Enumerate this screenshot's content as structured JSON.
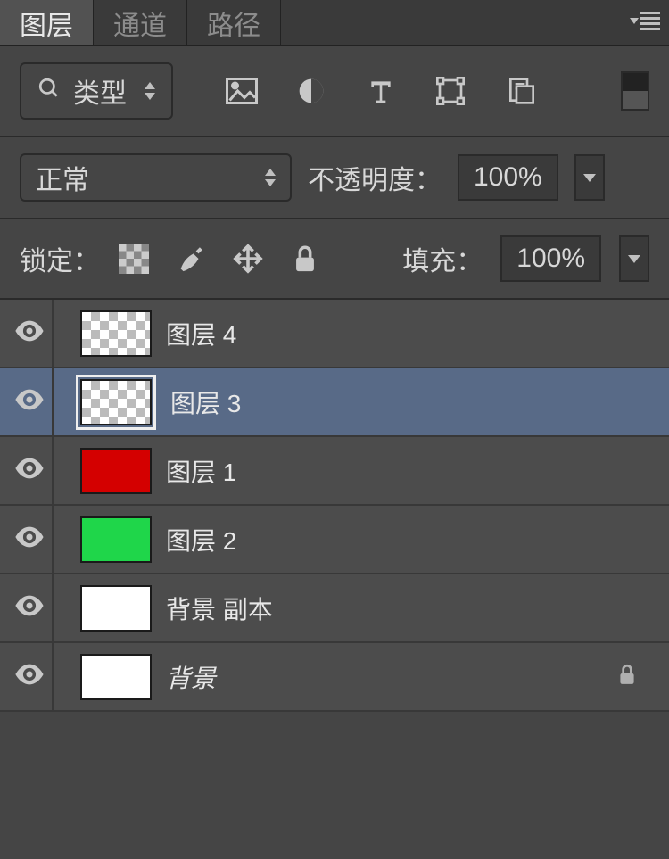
{
  "tabs": {
    "active": "图层",
    "items": [
      "图层",
      "通道",
      "路径"
    ]
  },
  "filter": {
    "kind_label": "类型"
  },
  "blend": {
    "mode": "正常",
    "opacity_label": "不透明度：",
    "opacity_value": "100%"
  },
  "lock": {
    "label": "锁定：",
    "fill_label": "填充：",
    "fill_value": "100%"
  },
  "layers": [
    {
      "name": "图层 4",
      "thumb": "transparent",
      "selected": false,
      "locked": false,
      "italic": false
    },
    {
      "name": "图层 3",
      "thumb": "transparent",
      "selected": true,
      "locked": false,
      "italic": false
    },
    {
      "name": "图层 1",
      "thumb": "#d40000",
      "selected": false,
      "locked": false,
      "italic": false
    },
    {
      "name": "图层 2",
      "thumb": "#1fd64a",
      "selected": false,
      "locked": false,
      "italic": false
    },
    {
      "name": "背景 副本",
      "thumb": "#ffffff",
      "selected": false,
      "locked": false,
      "italic": false
    },
    {
      "name": "背景",
      "thumb": "#ffffff",
      "selected": false,
      "locked": true,
      "italic": true
    }
  ]
}
